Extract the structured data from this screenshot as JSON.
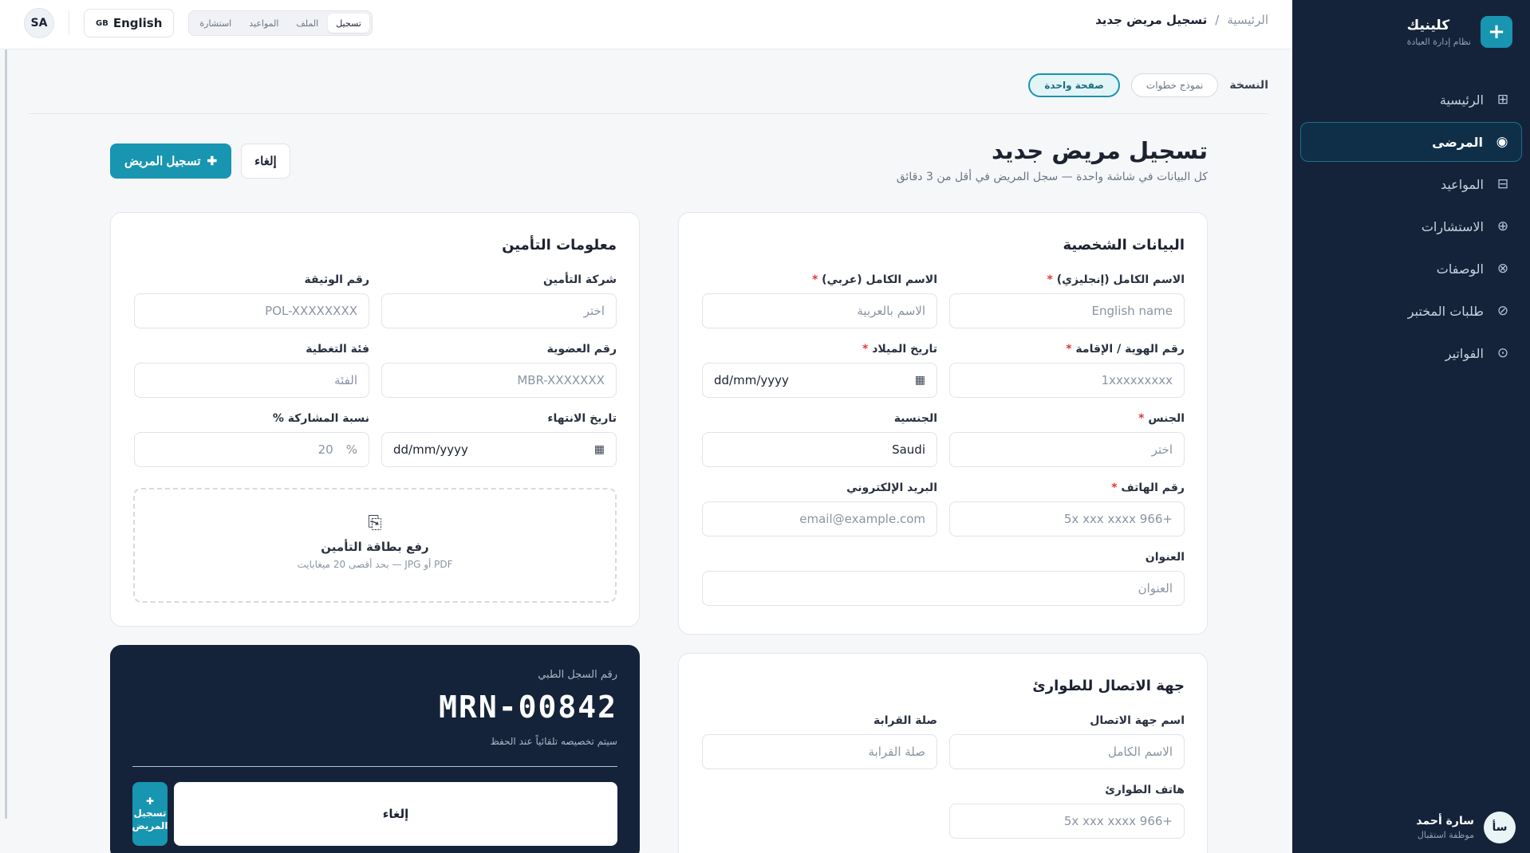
{
  "sidebar": {
    "brand_name": "كلينيك",
    "brand_sub": "نظام إدارة العيادة",
    "brand_logo": "+",
    "items": [
      {
        "label": "الرئيسية",
        "icon": "grid-icon"
      },
      {
        "label": "المرضى",
        "icon": "target-icon"
      },
      {
        "label": "المواعيد",
        "icon": "calendar-icon"
      },
      {
        "label": "الاستشارات",
        "icon": "globe-icon"
      },
      {
        "label": "الوصفات",
        "icon": "x-circle-icon"
      },
      {
        "label": "طلبات المختبر",
        "icon": "ban-icon"
      },
      {
        "label": "الفواتير",
        "icon": "clock-icon"
      }
    ],
    "user": {
      "initials": "سأ",
      "name": "سارة أحمد",
      "role": "موظفة استقبال"
    }
  },
  "topbar": {
    "breadcrumb_home": "الرئيسية",
    "breadcrumb_sep": "/",
    "breadcrumb_current": "تسجيل مريض جديد",
    "tabs": [
      "تسجيل",
      "الملف",
      "المواعيد",
      "استشارة"
    ],
    "lang_flag": "GB",
    "lang_label": "English",
    "user_badge": "SA"
  },
  "version": {
    "label": "النسخة",
    "options": [
      "صفحة واحدة",
      "نموذج خطوات"
    ]
  },
  "page": {
    "title": "تسجيل مريض جديد",
    "subtitle": "كل البيانات في شاشة واحدة — سجل المريض في أقل من 3 دقائق",
    "register_label": "تسجيل المريض",
    "cancel_label": "إلغاء"
  },
  "personal": {
    "title": "البيانات الشخصية",
    "name_en_label": "الاسم الكامل (إنجليزي)",
    "name_en_ph": "English name",
    "name_ar_label": "الاسم الكامل (عربي)",
    "name_ar_ph": "الاسم بالعربية",
    "id_label": "رقم الهوية / الإقامة",
    "id_ph": "1xxxxxxxxx",
    "dob_label": "تاريخ الميلاد",
    "dob_value": "dd/mm/yyyy",
    "gender_label": "الجنس",
    "gender_ph": "اختر",
    "nationality_label": "الجنسية",
    "nationality_value": "Saudi",
    "phone_label": "رقم الهاتف",
    "phone_ph": "+966 5x xxx xxxx",
    "email_label": "البريد الإلكتروني",
    "email_ph": "email@example.com",
    "address_label": "العنوان",
    "address_ph": "العنوان",
    "required_mark": "*"
  },
  "insurance": {
    "title": "معلومات التأمين",
    "company_label": "شركة التأمين",
    "company_ph": "اختر",
    "policy_label": "رقم الوثيقة",
    "policy_ph": "POL-XXXXXXXX",
    "member_label": "رقم العضوية",
    "member_ph": "MBR-XXXXXXX",
    "class_label": "فئة التغطية",
    "class_ph": "الفئة",
    "expiry_label": "تاريخ الانتهاء",
    "expiry_value": "dd/mm/yyyy",
    "copay_label": "نسبة المشاركة %",
    "copay_value": "20",
    "copay_unit": "%",
    "upload_title": "رفع بطاقة التأمين",
    "upload_sub": "PDF أو JPG — بحد أقصى 20 ميغابايت",
    "upload_icon": "paperclip-icon"
  },
  "emergency": {
    "title": "جهة الاتصال للطوارئ",
    "contact_label": "اسم جهة الاتصال",
    "contact_ph": "الاسم الكامل",
    "relation_label": "صلة القرابة",
    "relation_ph": "صلة القرابة",
    "phone_label": "هاتف الطوارئ",
    "phone_ph": "+966 5x xxx xxxx"
  },
  "mrn": {
    "label": "رقم السجل الطبي",
    "value": "MRN-00842",
    "note": "سيتم تخصيصه تلقائياً عند الحفظ",
    "cancel_label": "إلغاء",
    "register_label": "تسجيل المريض"
  },
  "colors": {
    "accent": "#1895b0",
    "sidebar_bg": "#15233a",
    "required": "#e03a3a"
  }
}
